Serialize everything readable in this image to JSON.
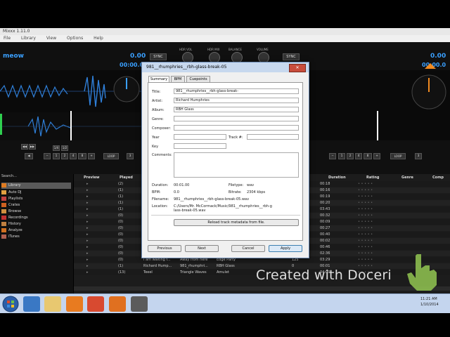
{
  "window": {
    "title": "Mixxx 1.11.0",
    "menu": [
      "File",
      "Library",
      "View",
      "Options",
      "Help"
    ]
  },
  "deck_left": {
    "track_title": "meow",
    "bpm": "0.00",
    "time": "00:00.00",
    "sync_label": "SYNC",
    "loop_label": "LOOP",
    "loop_sizes": [
      "1",
      "2",
      "4",
      "8",
      "16"
    ],
    "loop_fracs": [
      "1/4",
      "1/2"
    ]
  },
  "deck_right": {
    "bpm": "0.00",
    "time": "00:00.0",
    "sync_label": "SYNC",
    "loop_label": "LOOP",
    "loop_sizes": [
      "1",
      "2",
      "4",
      "8",
      "16"
    ]
  },
  "mixer": {
    "knob_labels": [
      "HDR VOL",
      "HDR MIX",
      "BALANCE",
      "VOLUME"
    ]
  },
  "library": {
    "search_placeholder": "Search...",
    "sidebar": [
      {
        "label": "Library",
        "icon": "library-icon"
      },
      {
        "label": "Auto DJ",
        "icon": "autodj-icon"
      },
      {
        "label": "Playlists",
        "icon": "playlist-icon"
      },
      {
        "label": "Crates",
        "icon": "crate-icon"
      },
      {
        "label": "Browse",
        "icon": "browse-icon"
      },
      {
        "label": "Recordings",
        "icon": "record-icon"
      },
      {
        "label": "History",
        "icon": "history-icon"
      },
      {
        "label": "Analyze",
        "icon": "analyze-icon"
      },
      {
        "label": "iTunes",
        "icon": "itunes-icon"
      }
    ],
    "columns": {
      "preview": "Preview",
      "played": "Played",
      "duration": "Duration",
      "rating": "Rating",
      "genre": "Genre",
      "comp": "Comp"
    },
    "rows": [
      {
        "played": "(2)",
        "artist": "",
        "title": "",
        "album": "",
        "bpm": "",
        "duration": "00:18"
      },
      {
        "played": "(1)",
        "artist": "",
        "title": "",
        "album": "",
        "bpm": "",
        "duration": "00:16"
      },
      {
        "played": "(1)",
        "artist": "",
        "title": "",
        "album": "",
        "bpm": "",
        "duration": "00:19"
      },
      {
        "played": "(1)",
        "artist": "",
        "title": "",
        "album": "",
        "bpm": "",
        "duration": "00:20"
      },
      {
        "played": "(1)",
        "artist": "",
        "title": "",
        "album": "",
        "bpm": "",
        "duration": "03:43"
      },
      {
        "played": "(0)",
        "artist": "",
        "title": "",
        "album": "",
        "bpm": "",
        "duration": "00:32"
      },
      {
        "played": "(0)",
        "artist": "",
        "title": "",
        "album": "",
        "bpm": "",
        "duration": "00:09"
      },
      {
        "played": "(0)",
        "artist": "",
        "title": "",
        "album": "",
        "bpm": "",
        "duration": "00:27"
      },
      {
        "played": "(0)",
        "artist": "",
        "title": "",
        "album": "",
        "bpm": "",
        "duration": "00:40"
      },
      {
        "played": "(0)",
        "artist": "",
        "title": "",
        "album": "",
        "bpm": "",
        "duration": "00:02"
      },
      {
        "played": "(0)",
        "artist": "",
        "title": "",
        "album": "",
        "bpm": "",
        "duration": "00:46"
      },
      {
        "played": "(0)",
        "artist": "",
        "title": "",
        "album": "",
        "bpm": "",
        "duration": "02:36"
      },
      {
        "played": "(0)",
        "artist": "I am waiting f...",
        "title": "Away from here",
        "album": "Edge Party",
        "bpm": "125",
        "duration": "03:29"
      },
      {
        "played": "(1)",
        "artist": "Richard Hump...",
        "title": "981_rhumphri...",
        "album": "RBH Glass",
        "bpm": "0",
        "duration": "00:01"
      },
      {
        "played": "(13)",
        "artist": "Teeel",
        "title": "Triangle Waves",
        "album": "Amulet",
        "bpm": "",
        "duration": "04:00"
      }
    ]
  },
  "dialog": {
    "title": "981__rhumphries__rbh-glass-break-05",
    "close_label": "✕",
    "tabs": [
      "Summary",
      "BPM",
      "Cuepoints"
    ],
    "fields": {
      "title_label": "Title:",
      "title_value": "981__rhumphries__rbh-glass-break-",
      "artist_label": "Artist:",
      "artist_value": "Richard Humphries",
      "album_label": "Album:",
      "album_value": "RBH Glass",
      "genre_label": "Genre:",
      "genre_value": "",
      "composer_label": "Composer:",
      "composer_value": "",
      "year_label": "Year",
      "year_value": "",
      "track_label": "Track #:",
      "track_value": "",
      "key_label": "Key",
      "key_value": "",
      "comments_label": "Comments:",
      "comments_value": ""
    },
    "info": {
      "duration_label": "Duration:",
      "duration_value": "00:01.00",
      "filetype_label": "Filetype:",
      "filetype_value": "wav",
      "bpm_label": "BPM:",
      "bpm_value": "0.0",
      "bitrate_label": "Bitrate:",
      "bitrate_value": "2304 kbps",
      "filename_label": "Filename:",
      "filename_value": "981__rhumphries__rbh-glass-break-05.wav",
      "location_label": "Location:",
      "location_value": "C:/Users/Mr. McCormack/Music/981__rhumphries__rbh-glass-break-05.wav"
    },
    "reload_label": "Reload track metadata from file.",
    "buttons": {
      "previous": "Previous",
      "next": "Next",
      "cancel": "Cancel",
      "apply": "Apply"
    }
  },
  "taskbar": {
    "clock_time": "11:21 AM",
    "clock_date": "1/10/2014"
  },
  "watermark": "Created with Doceri"
}
